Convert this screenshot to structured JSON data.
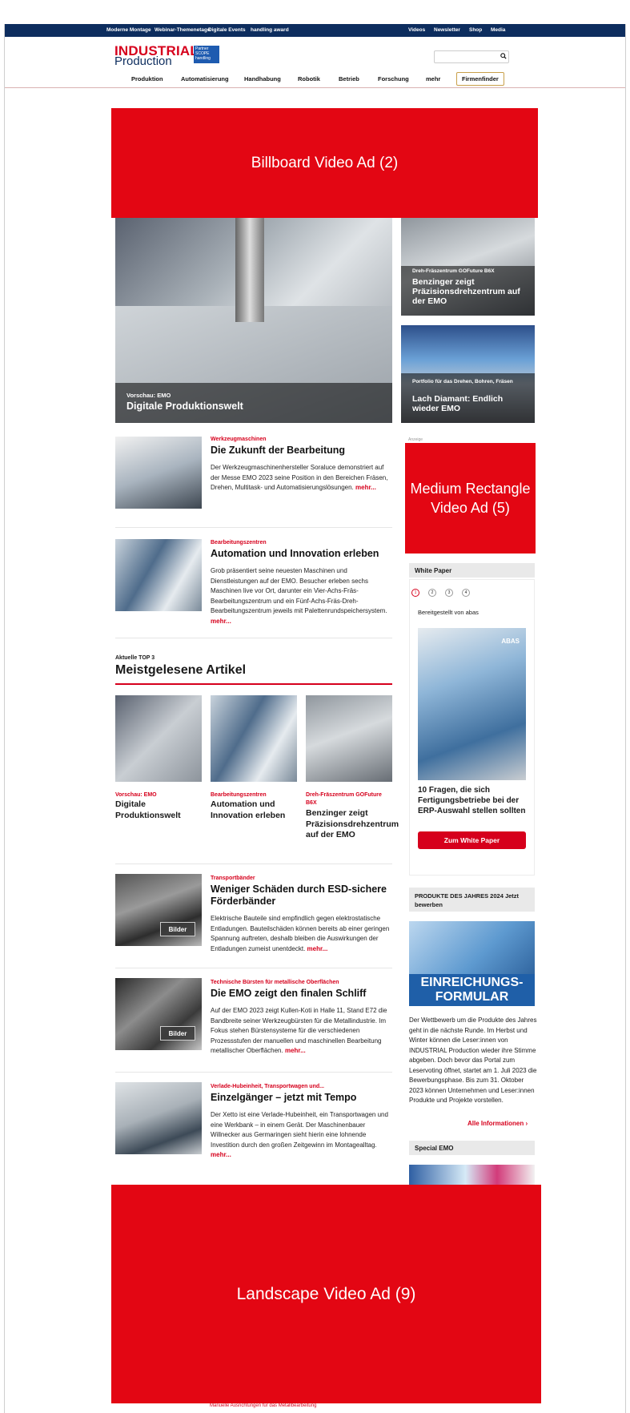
{
  "topbar": {
    "links": [
      "Moderne Montage",
      "Webinar-Themenetage",
      "Digitale Events",
      "handling award"
    ],
    "right_links": [
      "Videos",
      "Newsletter",
      "Shop",
      "Media"
    ]
  },
  "header": {
    "logo_line1": "INDUSTRIAL",
    "logo_line2": "Production",
    "badge": "Partner SCOPE handling",
    "search_placeholder": ""
  },
  "nav": {
    "items": [
      "Produktion",
      "Automatisierung",
      "Handhabung",
      "Robotik",
      "Betrieb",
      "Forschung",
      "mehr"
    ],
    "firmenfinder": "Firmenfinder"
  },
  "ads": {
    "billboard": "Billboard Video Ad (2)",
    "medrect": "Medium Rectangle Video Ad (5)",
    "landscape": "Landscape Video Ad (9)",
    "label": "Anzeige"
  },
  "hero": {
    "kicker": "Vorschau: EMO",
    "title": "Digitale Produktionswelt"
  },
  "side_cards": [
    {
      "kicker": "Dreh-Fräszentrum GOFuture B6X",
      "title": "Benzinger zeigt Präzisionsdrehzentrum auf der EMO"
    },
    {
      "kicker": "Portfolio für das Drehen, Bohren, Fräsen",
      "title": "Lach Diamant: Endlich wieder EMO"
    }
  ],
  "articles": [
    {
      "kicker": "Werkzeugmaschinen",
      "title": "Die Zukunft der Bearbeitung",
      "text": "Der Werkzeugmaschinenhersteller Soraluce demonstriert auf der Messe EMO 2023 seine Position in den Bereichen Fräsen, Drehen, Multitask- und Automatisierungslösungen.",
      "more": "mehr..."
    },
    {
      "kicker": "Bearbeitungszentren",
      "title": "Automation und Innovation erleben",
      "text": "Grob präsentiert seine neuesten Maschinen und Dienstleistungen auf der EMO. Besucher erleben sechs Maschinen live vor Ort, darunter ein Vier-Achs-Fräs-Bearbeitungszentrum und ein Fünf-Achs-Fräs-Dreh-Bearbeitungszentrum jeweils mit Palettenrundspeichersystem.",
      "more": "mehr..."
    }
  ],
  "top3": {
    "kicker": "Aktuelle TOP 3",
    "title": "Meistgelesene Artikel",
    "items": [
      {
        "kicker": "Vorschau: EMO",
        "title": "Digitale Produktionswelt"
      },
      {
        "kicker": "Bearbeitungszentren",
        "title": "Automation und Innovation erleben"
      },
      {
        "kicker": "Dreh-Fräszentrum GOFuture B6X",
        "title": "Benzinger zeigt Präzisionsdrehzentrum auf der EMO"
      }
    ]
  },
  "articles2": [
    {
      "kicker": "Transportbänder",
      "title": "Weniger Schäden durch ESD-sichere Förderbänder",
      "text": "Elektrische Bauteile sind empfindlich gegen elektrostatische Entladungen. Bauteilschäden können bereits ab einer geringen Spannung auftreten, deshalb bleiben die Auswirkungen der Entladungen zumeist unentdeckt.",
      "more": "mehr...",
      "badge": "Bilder"
    },
    {
      "kicker": "Technische Bürsten für metallische Oberflächen",
      "title": "Die EMO zeigt den finalen Schliff",
      "text": "Auf der EMO 2023 zeigt Kullen-Koti in Halle 11, Stand E72 die Bandbreite seiner Werkzeugbürsten für die Metallindustrie. Im Fokus stehen Bürstensysteme für die verschiedenen Prozessstufen der manuellen und maschinellen Bearbeitung metallischer Oberflächen.",
      "more": "mehr...",
      "badge": "Bilder"
    },
    {
      "kicker": "Verlade-Hubeinheit, Transportwagen und...",
      "title": "Einzelgänger – jetzt mit Tempo",
      "text": "Der Xetto ist eine Verlade-Hubeinheit, ein Transportwagen und eine Werkbank – in einem Gerät. Der Maschinenbauer Willnecker aus Germaringen sieht hierin eine lohnende Investition durch den großen Zeitgewinn im Montagealltag.",
      "more": "mehr..."
    }
  ],
  "whitepaper": {
    "header": "White Paper",
    "dots": [
      "1",
      "2",
      "3",
      "4"
    ],
    "provider": "Bereitgestellt von abas",
    "image_brand": "ABAS",
    "title": "10 Fragen, die sich Fertigungsbetriebe bei der ERP-Auswahl stellen sollten",
    "button": "Zum White Paper"
  },
  "pdj": {
    "header": "PRODUKTE DES JAHRES 2024 Jetzt bewerben",
    "image_text": "EINREICHUNGS-FORMULAR",
    "text": "Der Wettbewerb um die Produkte des Jahres geht in die nächste Runde. Im Herbst und Winter können die Leser:innen von INDUSTRIAL Production wieder ihre Stimme abgeben. Doch bevor das Portal zum Leservoting öffnet, startet am 1. Juli 2023 die Bewerbungsphase. Bis zum 31. Oktober 2023 können Unternehmen und Leser:innen Produkte und Projekte vorstellen.",
    "link": "Alle Informationen"
  },
  "special_emo": {
    "header": "Special EMO"
  },
  "footnote": "Manuelle Ausrichtungen für das Metallbearbeitung"
}
